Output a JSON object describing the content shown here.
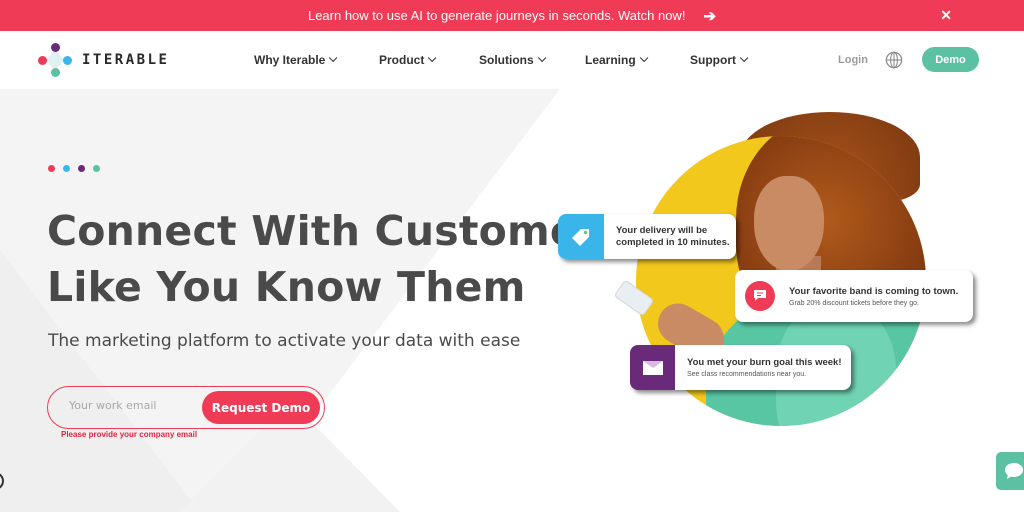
{
  "announcement": {
    "message": "Learn how to use AI to generate journeys in seconds. Watch now!",
    "arrow_icon": "arrow-right-icon",
    "close_label": "✕"
  },
  "nav": {
    "logo_text": "ITERABLE",
    "menu": [
      {
        "label": "Why Iterable"
      },
      {
        "label": "Product"
      },
      {
        "label": "Solutions"
      },
      {
        "label": "Learning"
      },
      {
        "label": "Support"
      }
    ],
    "login_label": "Login",
    "globe_icon": "globe-icon",
    "demo_label": "Demo"
  },
  "hero": {
    "dots_colors": [
      "#ef3b55",
      "#3ab5ea",
      "#6a2a7a",
      "#5cc0a3"
    ],
    "headline_line1": "Connect With Customers",
    "headline_line2": "Like You Know Them",
    "subheadline": "The marketing platform to activate your data with ease",
    "email_placeholder": "Your work email",
    "email_value": "",
    "request_button": "Request Demo",
    "email_error": "Please provide your company email"
  },
  "notifications": [
    {
      "icon": "tag-icon",
      "title_line1": "Your delivery will be",
      "title_line2": "completed in 10 minutes.",
      "subtitle": ""
    },
    {
      "icon": "message-icon",
      "title_line1": "Your favorite band is coming to town.",
      "title_line2": "",
      "subtitle": "Grab 20% discount tickets before they go."
    },
    {
      "icon": "mail-icon",
      "title_line1": "You met your burn goal this week!",
      "title_line2": "",
      "subtitle": "See class recommendations near you."
    }
  ],
  "colors": {
    "brand_red": "#ef3b55",
    "brand_teal": "#5cc0a3",
    "brand_blue": "#3ab5ea",
    "brand_purple": "#6a2a7a",
    "accent_yellow": "#f2c81c"
  },
  "chat_widget": {
    "icon": "chat-bubble-icon"
  }
}
